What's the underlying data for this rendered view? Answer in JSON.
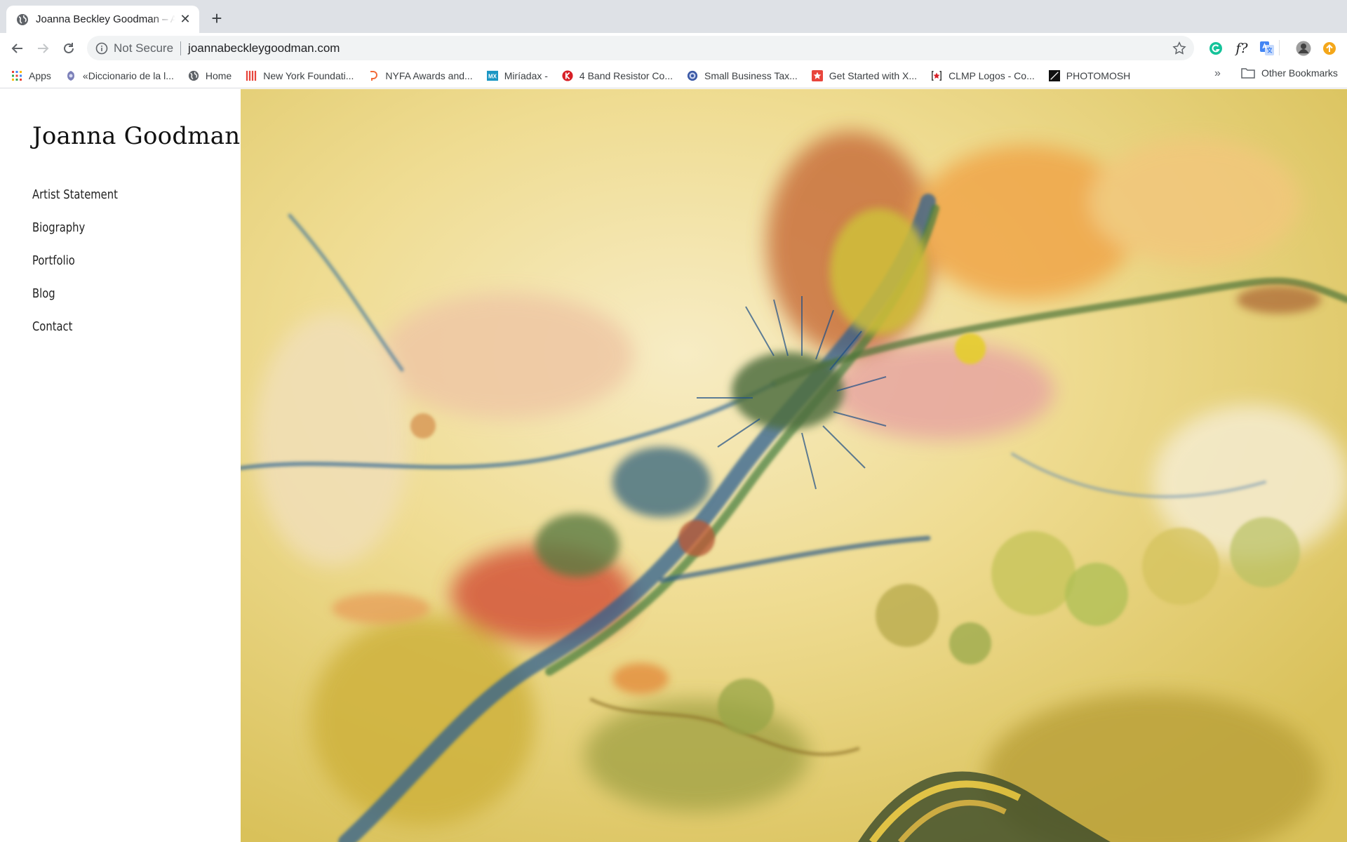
{
  "browser": {
    "tab": {
      "title": "Joanna Beckley Goodman – Artist",
      "close_glyph": "✕",
      "icon": "globe-icon"
    },
    "new_tab_glyph": "+",
    "omnibox": {
      "security_label": "Not Secure",
      "url": "joannabeckleygoodman.com"
    },
    "extensions": {
      "font_ext_label": "f?"
    },
    "bookmarks": [
      {
        "label": "Apps",
        "icon": "apps-grid-icon"
      },
      {
        "label": "«Diccionario de la l...",
        "icon": "rae-crest-icon"
      },
      {
        "label": "Home",
        "icon": "globe-icon"
      },
      {
        "label": "New York Foundati...",
        "icon": "nyfa-bars-icon"
      },
      {
        "label": "NYFA Awards and...",
        "icon": "submittable-icon"
      },
      {
        "label": "Miríadax -",
        "icon": "miriadax-icon"
      },
      {
        "label": "4 Band Resistor Co...",
        "icon": "resistor-k-icon"
      },
      {
        "label": "Small Business Tax...",
        "icon": "seal-icon"
      },
      {
        "label": "Get Started with X...",
        "icon": "xero-icon"
      },
      {
        "label": "CLMP Logos - Co...",
        "icon": "clmp-icon"
      },
      {
        "label": "PHOTOMOSH",
        "icon": "photomosh-icon"
      }
    ],
    "bookmarks_overflow": "»",
    "other_bookmarks": "Other Bookmarks"
  },
  "site": {
    "title": "Joanna Goodman",
    "nav": [
      "Artist Statement",
      "Biography",
      "Portfolio",
      "Blog",
      "Contact"
    ]
  },
  "colors": {
    "tabstrip": "#dee1e6",
    "omnibox": "#f1f3f4",
    "grammarly": "#15c39a",
    "translate": "#4285f4",
    "orange_ext": "#f4a71a"
  }
}
